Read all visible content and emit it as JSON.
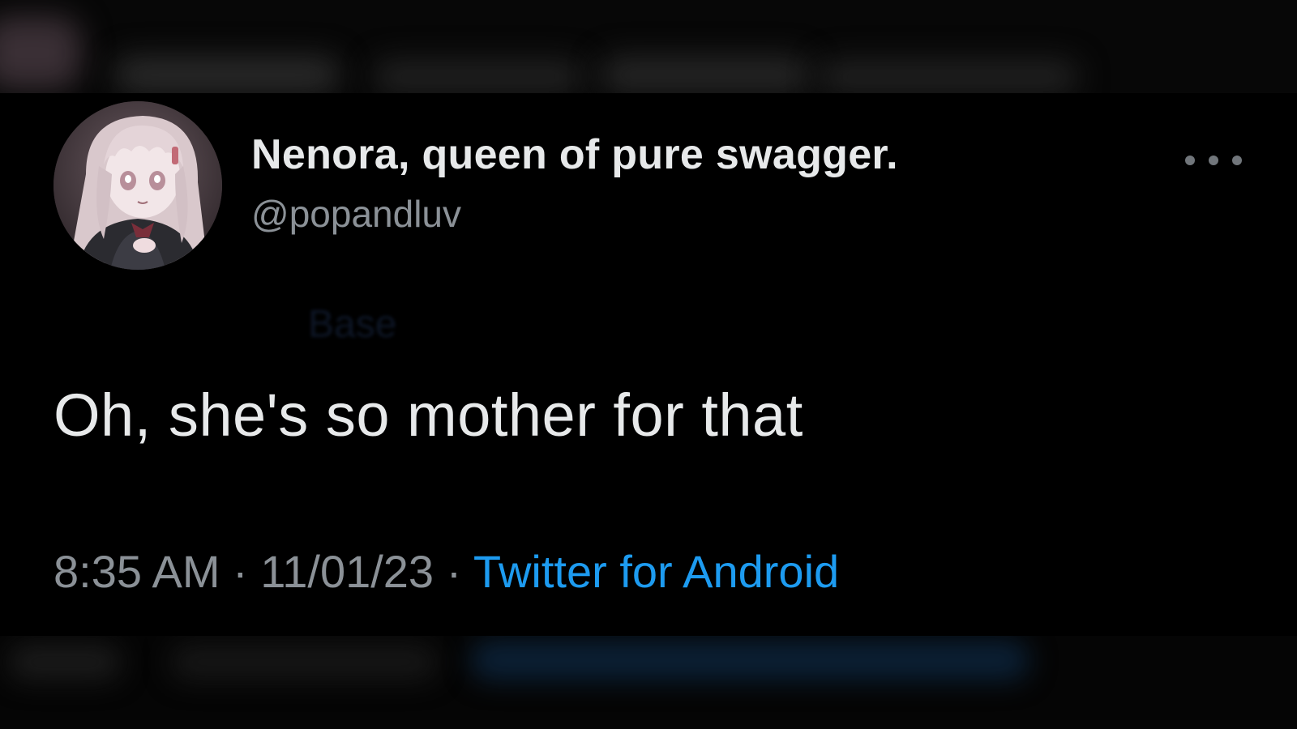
{
  "tweet": {
    "display_name": "Nenora, queen of pure swagger.",
    "handle": "@popandluv",
    "faded_overlay_text": "Base",
    "text": "Oh, she's so mother for that",
    "time": "8:35 AM",
    "date": "11/01/23",
    "separator": "·",
    "source": "Twitter for Android",
    "more_icon": "more-horizontal-icon"
  },
  "colors": {
    "background": "#000000",
    "primary_text": "#e7e9ea",
    "secondary_text": "#8b9197",
    "link": "#1d9bf0"
  }
}
